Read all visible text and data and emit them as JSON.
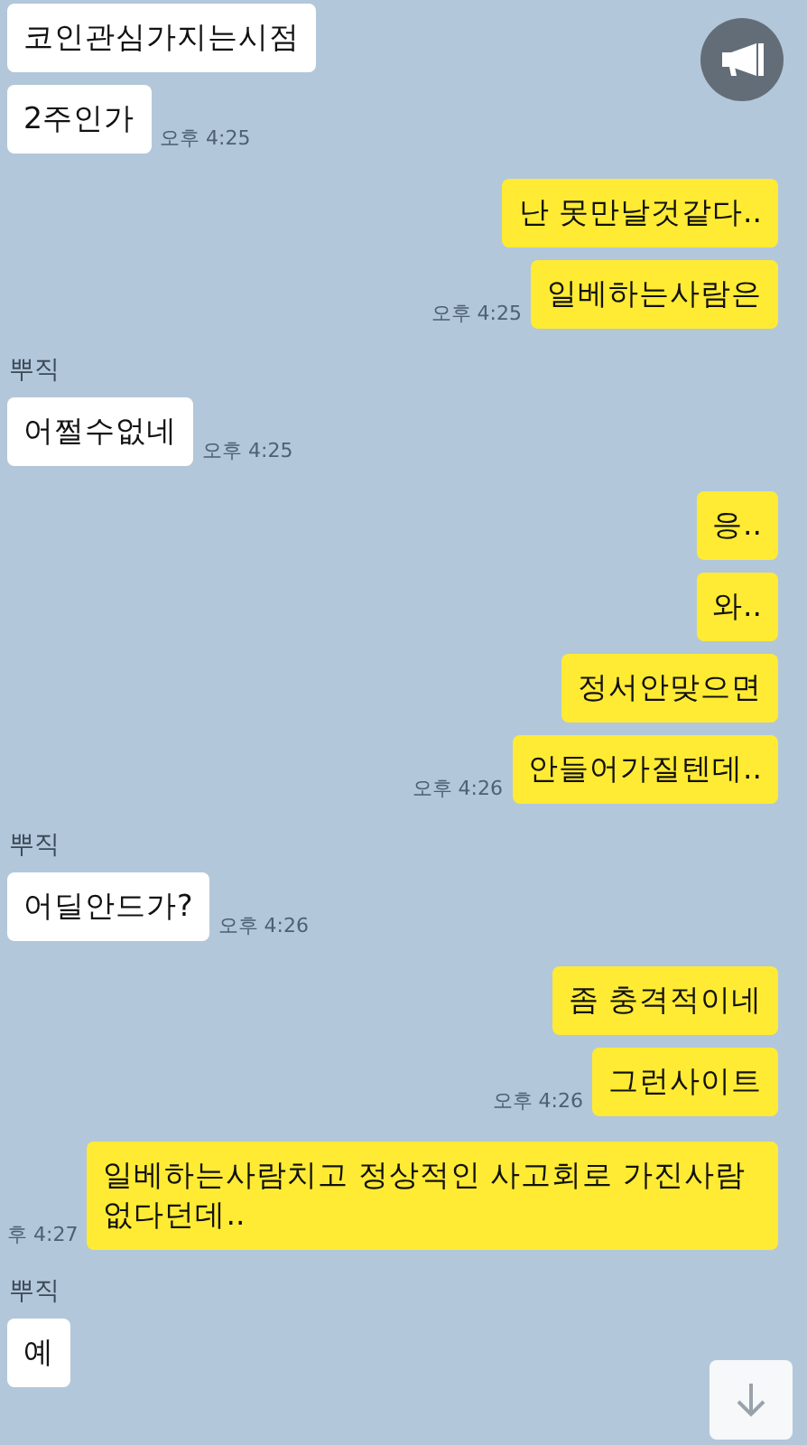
{
  "notice_button": {
    "kind": "megaphone"
  },
  "blocks": [
    {
      "kind": "incoming",
      "messages": [
        "코인관심가지는시점",
        "2주인가"
      ],
      "time": "오후 4:25"
    },
    {
      "kind": "outgoing",
      "messages": [
        "난 못만날것같다..",
        "일베하는사람은"
      ],
      "time": "오후 4:25"
    },
    {
      "kind": "incoming",
      "sender": "뿌직",
      "messages": [
        "어쩔수없네"
      ],
      "time": "오후 4:25"
    },
    {
      "kind": "outgoing",
      "messages": [
        "응..",
        "와..",
        "정서안맞으면",
        "안들어가질텐데.."
      ],
      "time": "오후 4:26"
    },
    {
      "kind": "incoming",
      "sender": "뿌직",
      "messages": [
        "어딜안드가?"
      ],
      "time": "오후 4:26"
    },
    {
      "kind": "outgoing",
      "messages": [
        "좀 충격적이네",
        "그런사이트"
      ],
      "time": "오후 4:26"
    },
    {
      "kind": "outgoing",
      "messages": [
        "일베하는사람치고 정상적인 사고회로 가진사람 없다던데.."
      ],
      "time": "후 4:27"
    },
    {
      "kind": "incoming",
      "sender": "뿌직",
      "messages": [
        "예"
      ]
    }
  ],
  "scroll_down_button": {
    "kind": "arrow-down"
  }
}
